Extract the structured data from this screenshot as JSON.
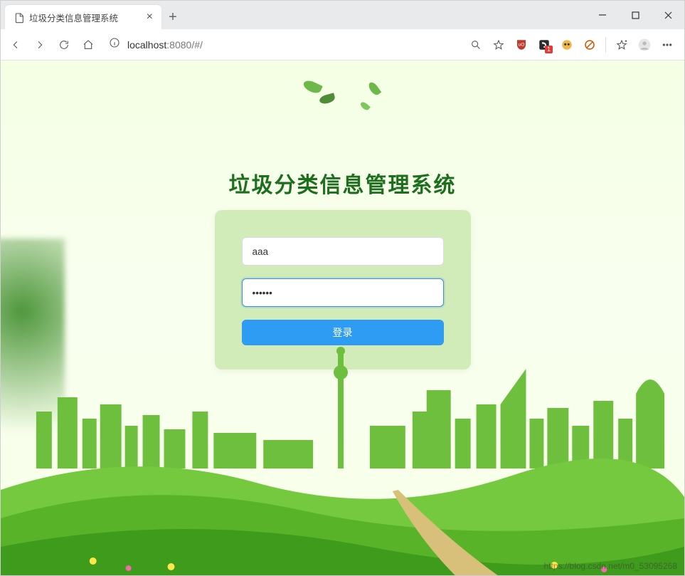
{
  "browser": {
    "tab_title": "垃圾分类信息管理系统",
    "new_tab_label": "+",
    "nav": {
      "back": "←",
      "forward": "→",
      "refresh_icon": "refresh-icon",
      "home_icon": "home-icon",
      "info_icon": "info-icon"
    },
    "url_host": "localhost",
    "url_port": ":8080",
    "url_path": "/#/",
    "right": {
      "search_icon": "search-icon",
      "favorite_icon": "star-outline-icon",
      "ext_ublock": "uBlock",
      "ext_evernote": "Evernote",
      "ext_evernote_badge": "1",
      "ext_owl": "ext",
      "ext_block2": "ext",
      "collections_icon": "collections-icon",
      "profile_icon": "profile-icon",
      "more_icon": "more-icon"
    },
    "window_controls": {
      "min": "—",
      "max": "▢",
      "close": "✕"
    }
  },
  "page": {
    "title": "垃圾分类信息管理系统",
    "username_value": "aaa",
    "username_placeholder": "",
    "password_value": "••••••",
    "password_placeholder": "",
    "login_label": "登录",
    "watermark": "https://blog.csdn.net/m0_53095268"
  },
  "colors": {
    "brand_green": "#1d6e1d",
    "card_green": "#d1ecb8",
    "btn_blue": "#2e9cf3",
    "focus_blue": "#3a8ee6",
    "bg_grad_top": "#f4ffe4"
  }
}
